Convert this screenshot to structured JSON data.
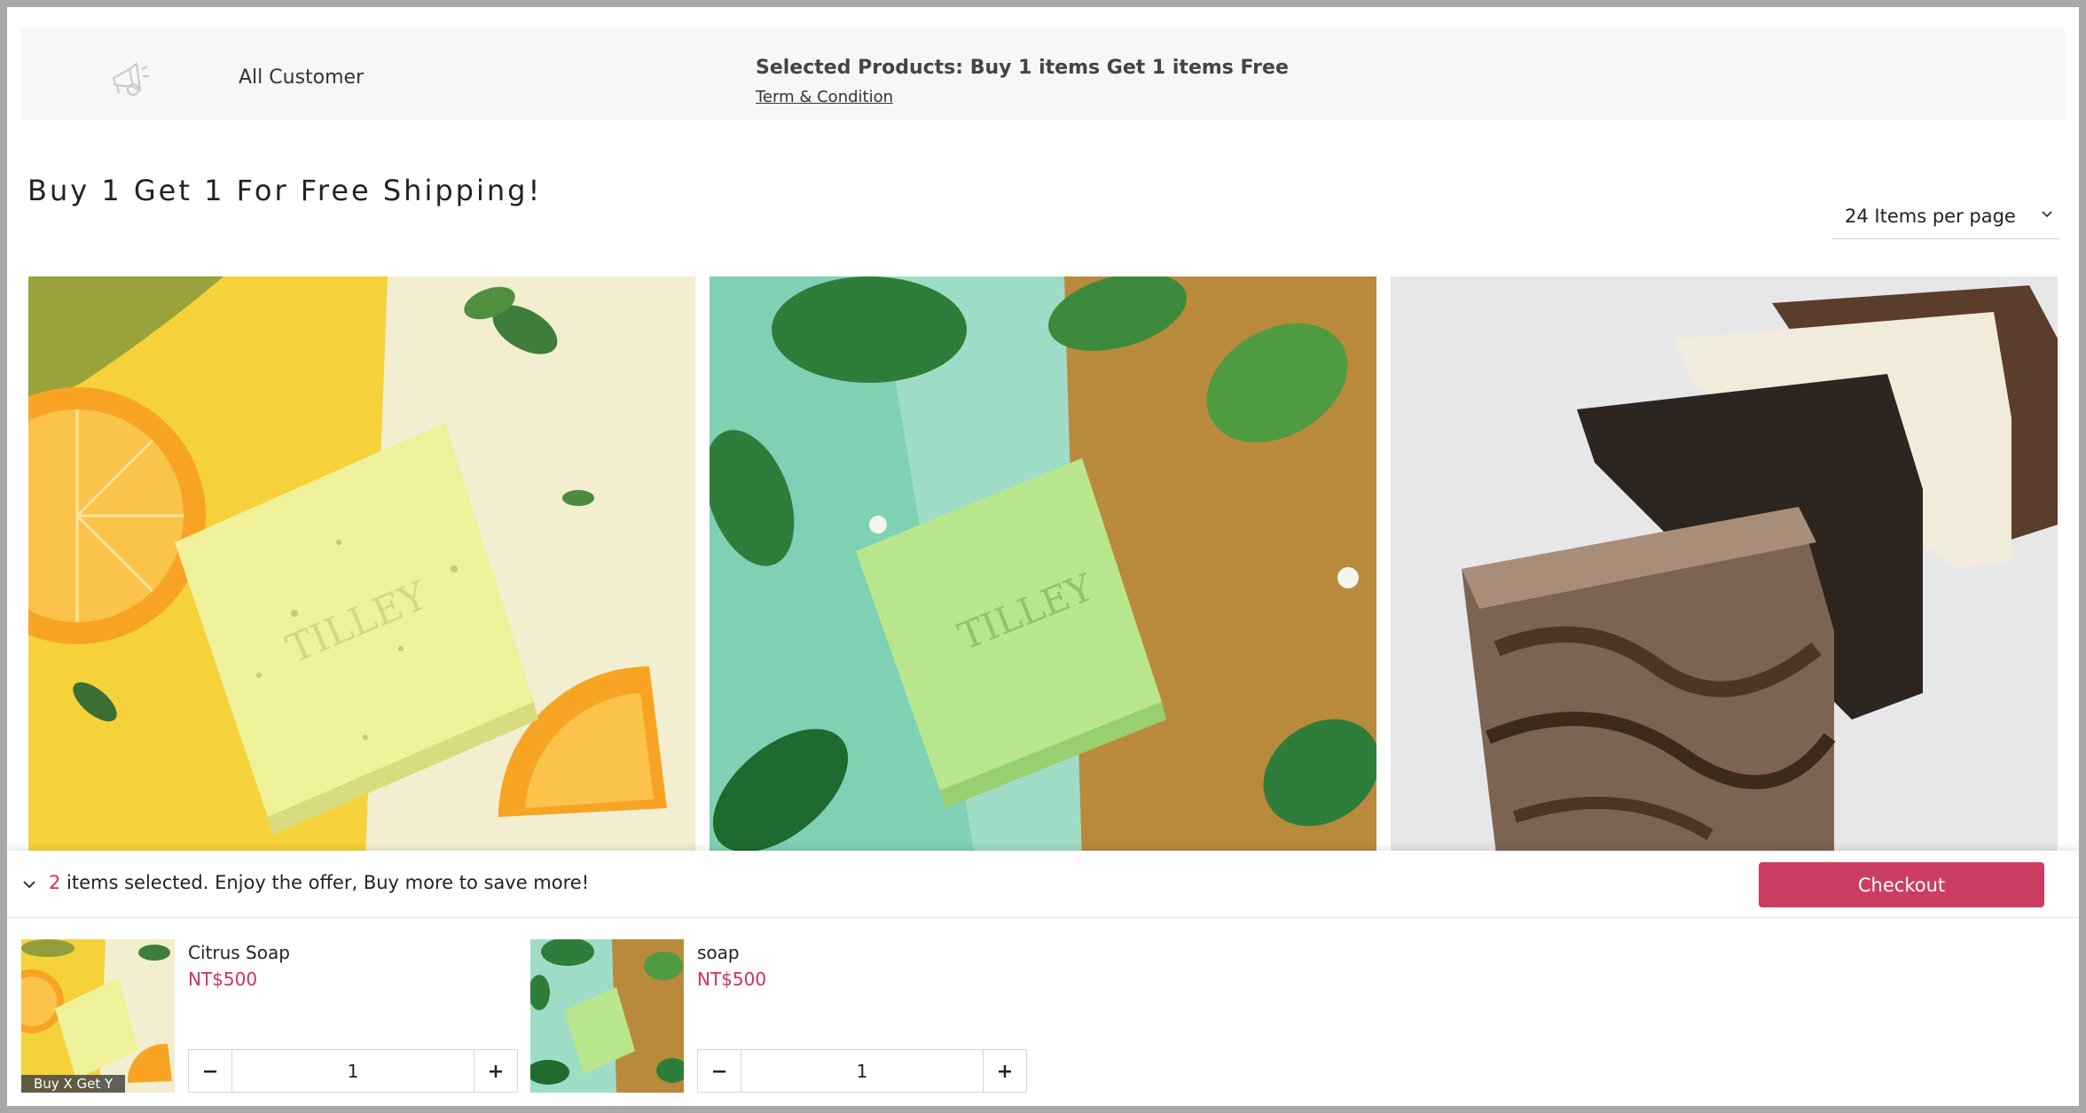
{
  "promo": {
    "icon": "megaphone-icon",
    "audience": "All Customer",
    "title": "Selected Products: Buy 1 items Get 1 items Free",
    "terms_link": "Term & Condition"
  },
  "page": {
    "title": "Buy 1 Get 1 For Free Shipping!",
    "per_page": "24 Items per page"
  },
  "products": [
    {
      "image": "citrus-soap-image"
    },
    {
      "image": "green-soap-image"
    },
    {
      "image": "bar-soaps-image"
    }
  ],
  "cart": {
    "count": "2",
    "summary": " items selected. Enjoy the offer, Buy more to save more!",
    "checkout_label": "Checkout",
    "items": [
      {
        "name": "Citrus Soap",
        "price": "NT$500",
        "qty": "1",
        "badge": "Buy X Get Y"
      },
      {
        "name": "soap",
        "price": "NT$500",
        "qty": "1"
      }
    ]
  },
  "colors": {
    "accent": "#cc3d62",
    "price": "#d0325a",
    "banner_bg": "#f7f7f7"
  }
}
